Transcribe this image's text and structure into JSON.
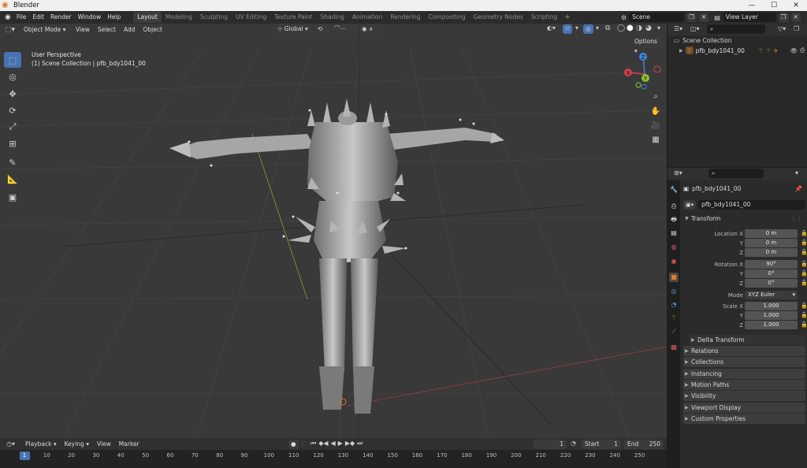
{
  "window": {
    "title": "Blender",
    "minimize": "—",
    "maximize": "☐",
    "close": "✕"
  },
  "menu": [
    "File",
    "Edit",
    "Render",
    "Window",
    "Help"
  ],
  "workspaces": [
    "Layout",
    "Modeling",
    "Sculpting",
    "UV Editing",
    "Texture Paint",
    "Shading",
    "Animation",
    "Rendering",
    "Compositing",
    "Geometry Nodes",
    "Scripting"
  ],
  "active_workspace": "Layout",
  "scene": {
    "name": "Scene",
    "view_layer": "View Layer"
  },
  "viewport": {
    "mode": "Object Mode",
    "menus": [
      "View",
      "Select",
      "Add",
      "Object"
    ],
    "transform_orientation": "Global",
    "options_label": "Options",
    "overlay_text_1": "User Perspective",
    "overlay_text_2": "(1) Scene Collection | pfb_bdy1041_00",
    "gizmo": {
      "x": "X",
      "y": "Y",
      "z": "Z"
    }
  },
  "tools": [
    {
      "name": "select-box-tool",
      "icon": "cursor-icon"
    },
    {
      "name": "cursor-tool",
      "icon": "3d-cursor-icon"
    },
    {
      "name": "move-tool",
      "icon": "move-icon"
    },
    {
      "name": "rotate-tool",
      "icon": "rotate-icon"
    },
    {
      "name": "scale-tool",
      "icon": "scale-icon"
    },
    {
      "name": "transform-tool",
      "icon": "transform-icon"
    },
    {
      "name": "annotate-tool",
      "icon": "pencil-icon"
    },
    {
      "name": "measure-tool",
      "icon": "ruler-icon"
    },
    {
      "name": "add-cube-tool",
      "icon": "cube-add-icon"
    }
  ],
  "outliner": {
    "root": "Scene Collection",
    "item": "pfb_bdy1041_00"
  },
  "properties": {
    "object_name": "pfb_bdy1041_00",
    "data_name": "pfb_bdy1041_00",
    "transform_label": "Transform",
    "location_label": "Location X",
    "location": [
      "0 m",
      "0 m",
      "0 m"
    ],
    "rotation_label": "Rotation X",
    "rotation": [
      "90°",
      "0°",
      "0°"
    ],
    "mode_label": "Mode",
    "mode_value": "XYZ Euler",
    "scale_label": "Scale X",
    "scale": [
      "1.000",
      "1.000",
      "1.000"
    ],
    "axis_y": "Y",
    "axis_z": "Z",
    "delta_transform": "Delta Transform",
    "panels": [
      "Relations",
      "Collections",
      "Instancing",
      "Motion Paths",
      "Visibility",
      "Viewport Display",
      "Custom Properties"
    ]
  },
  "timeline": {
    "menus": [
      "Playback",
      "Keying",
      "View",
      "Marker"
    ],
    "current_frame": "1",
    "start_label": "Start",
    "start": "1",
    "end_label": "End",
    "end": "250",
    "ticks": [
      "1",
      "10",
      "20",
      "30",
      "40",
      "50",
      "60",
      "70",
      "80",
      "90",
      "100",
      "110",
      "120",
      "130",
      "140",
      "150",
      "160",
      "170",
      "180",
      "190",
      "200",
      "210",
      "220",
      "230",
      "240",
      "250"
    ]
  },
  "colors": {
    "accent": "#4772b3",
    "object_orange": "#e8792b",
    "x_axis": "#d33f4f",
    "y_axis": "#8bc034",
    "z_axis": "#3d85d9"
  }
}
